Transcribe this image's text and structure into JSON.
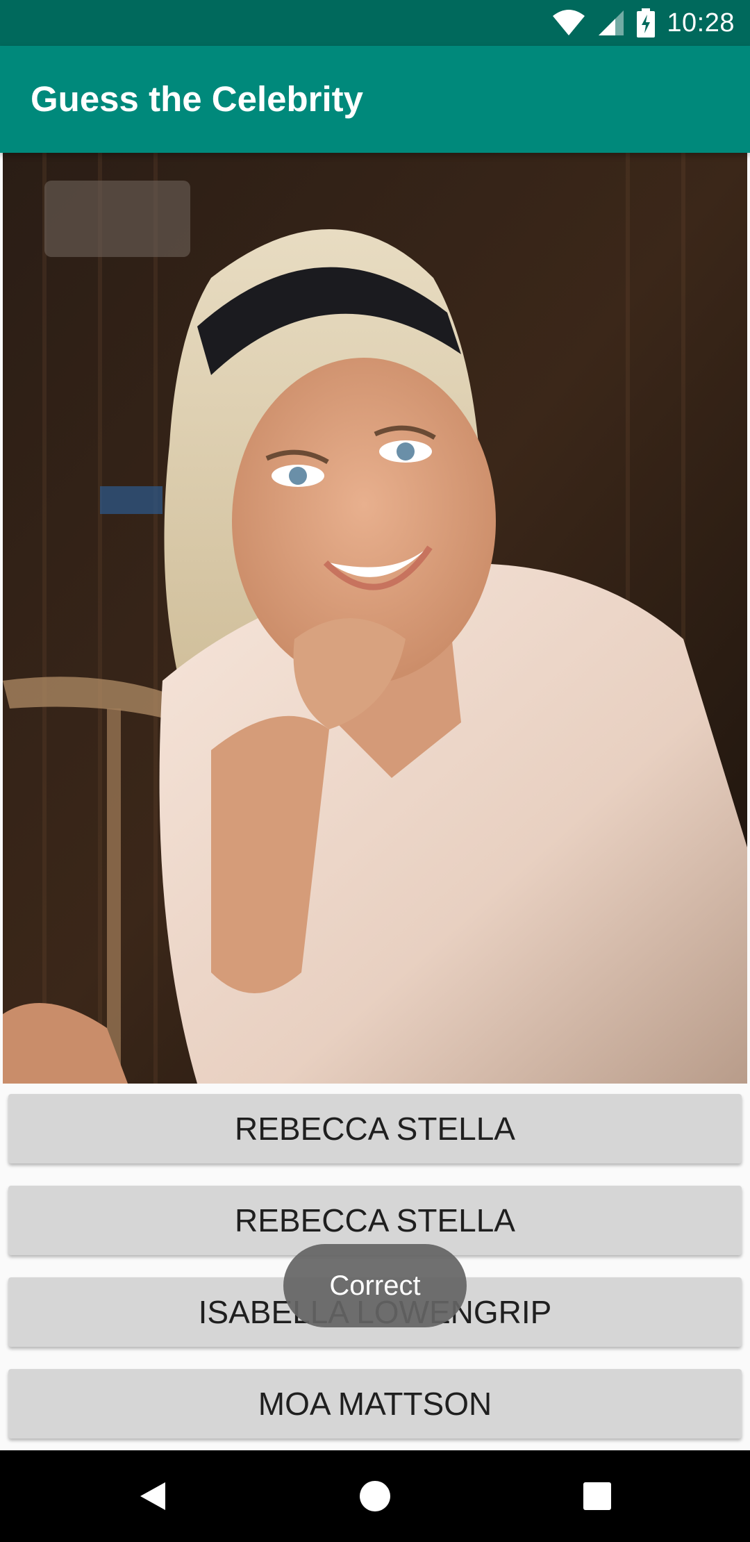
{
  "status_bar": {
    "time": "10:28",
    "icons": [
      "wifi-icon",
      "cell-signal-icon",
      "battery-charging-icon"
    ]
  },
  "app_bar": {
    "title": "Guess the Celebrity",
    "color": "#00897b"
  },
  "quiz": {
    "image_icon": "celebrity-photo",
    "answers": [
      "REBECCA STELLA",
      "REBECCA STELLA",
      "ISABELLA LOWENGRIP",
      "MOA MATTSON"
    ]
  },
  "toast": {
    "message": "Correct"
  },
  "nav_bar": {
    "icons": [
      "back-icon",
      "home-icon",
      "recents-icon"
    ]
  }
}
